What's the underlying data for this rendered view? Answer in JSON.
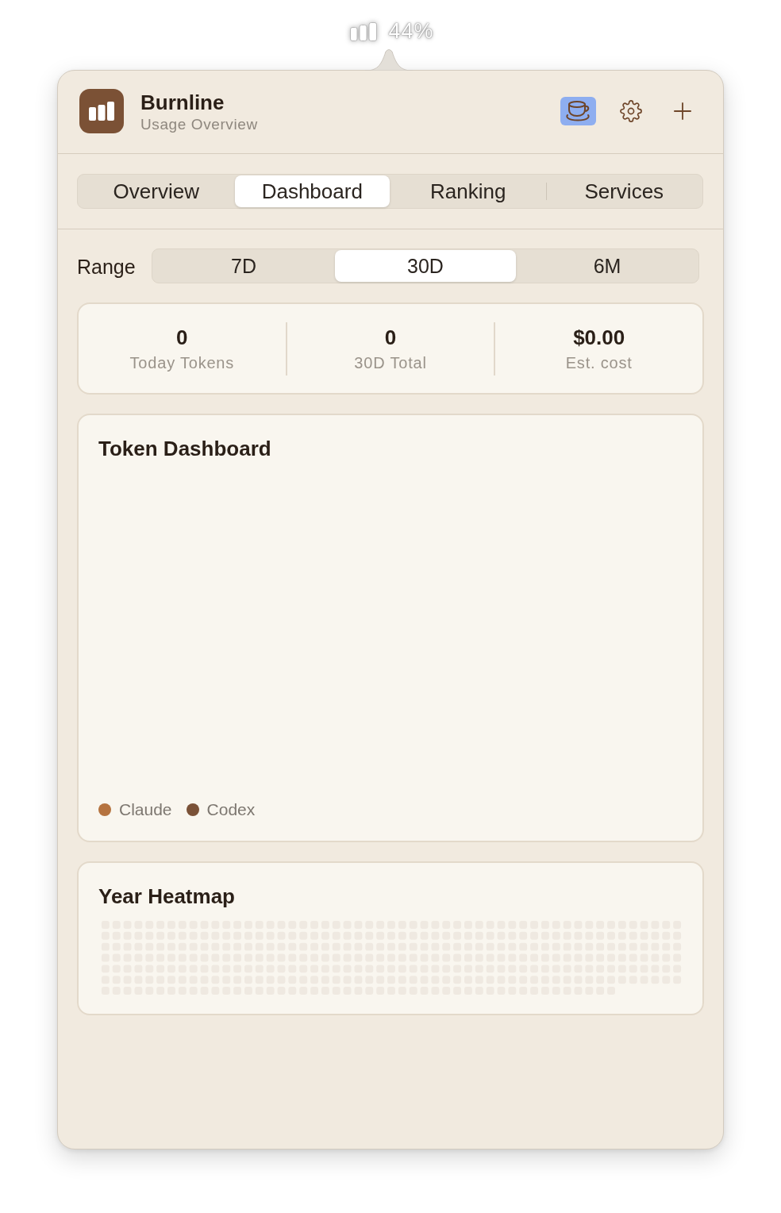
{
  "menu_bar_item": {
    "text": "44%"
  },
  "header": {
    "title": "Burnline",
    "subtitle": "Usage Overview",
    "toolbar": [
      {
        "kind": "cup",
        "selected": true
      },
      {
        "kind": "gear",
        "selected": false
      },
      {
        "kind": "plus",
        "selected": false
      }
    ]
  },
  "tabs": [
    {
      "label": "Overview",
      "selected": false
    },
    {
      "label": "Dashboard",
      "selected": true
    },
    {
      "label": "Ranking",
      "selected": false
    },
    {
      "label": "Services",
      "selected": false
    }
  ],
  "range": {
    "label": "Range",
    "options": [
      {
        "label": "7D",
        "selected": false
      },
      {
        "label": "30D",
        "selected": true
      },
      {
        "label": "6M",
        "selected": false
      }
    ]
  },
  "stats": [
    {
      "value": "0",
      "label": "Today Tokens"
    },
    {
      "value": "0",
      "label": "30D Total"
    },
    {
      "value": "$0.00",
      "label": "Est. cost"
    }
  ],
  "token_dashboard": {
    "title": "Token Dashboard",
    "legend": [
      {
        "name": "Claude",
        "color": "#b5733f"
      },
      {
        "name": "Codex",
        "color": "#7a5137"
      }
    ]
  },
  "year_heatmap": {
    "title": "Year Heatmap"
  }
}
